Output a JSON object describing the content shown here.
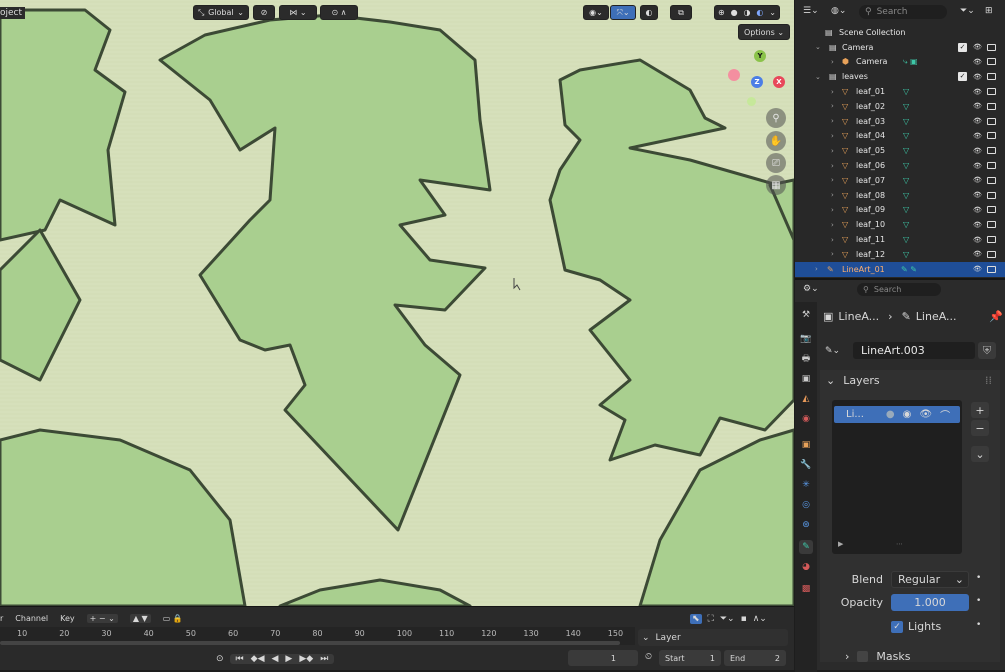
{
  "viewport": {
    "header": {
      "project_label": "oject",
      "orientation": "Global",
      "options_label": "Options"
    },
    "gizmo": {
      "y": "Y",
      "z": "Z",
      "x": "X"
    }
  },
  "timeline": {
    "menus": [
      "r",
      "Channel",
      "Key"
    ],
    "ruler_ticks": [
      "10",
      "20",
      "30",
      "40",
      "50",
      "60",
      "70",
      "80",
      "90",
      "100",
      "110",
      "120",
      "130",
      "140",
      "150"
    ],
    "current_frame": "1",
    "start_label": "Start",
    "start_value": "1",
    "end_label": "End",
    "end_value": "2",
    "layer_popover": "Layer"
  },
  "outliner": {
    "search_placeholder": "Search",
    "scene_collection": "Scene Collection",
    "camera_collection": "Camera",
    "camera_object": "Camera",
    "leaves_collection": "leaves",
    "leaves": [
      "leaf_01",
      "leaf_02",
      "leaf_03",
      "leaf_04",
      "leaf_05",
      "leaf_06",
      "leaf_07",
      "leaf_08",
      "leaf_09",
      "leaf_10",
      "leaf_11",
      "leaf_12"
    ],
    "selected_object": "LineArt_01"
  },
  "properties": {
    "search_placeholder": "Search",
    "breadcrumb_object": "LineA...",
    "breadcrumb_data": "LineA...",
    "datablock_name": "LineArt.003",
    "layers_panel": "Layers",
    "layer_item": "Li...",
    "blend_label": "Blend",
    "blend_value": "Regular",
    "opacity_label": "Opacity",
    "opacity_value": "1.000",
    "lights_label": "Lights",
    "masks_label": "Masks"
  },
  "colors": {
    "accent_blue": "#3e6fb8",
    "selected_row": "#1f4e98",
    "object_orange": "#e8a25a",
    "mesh_green": "#3ec8a8",
    "leaf_fill": "#a9cf8f",
    "paper": "#d8e2bd"
  }
}
